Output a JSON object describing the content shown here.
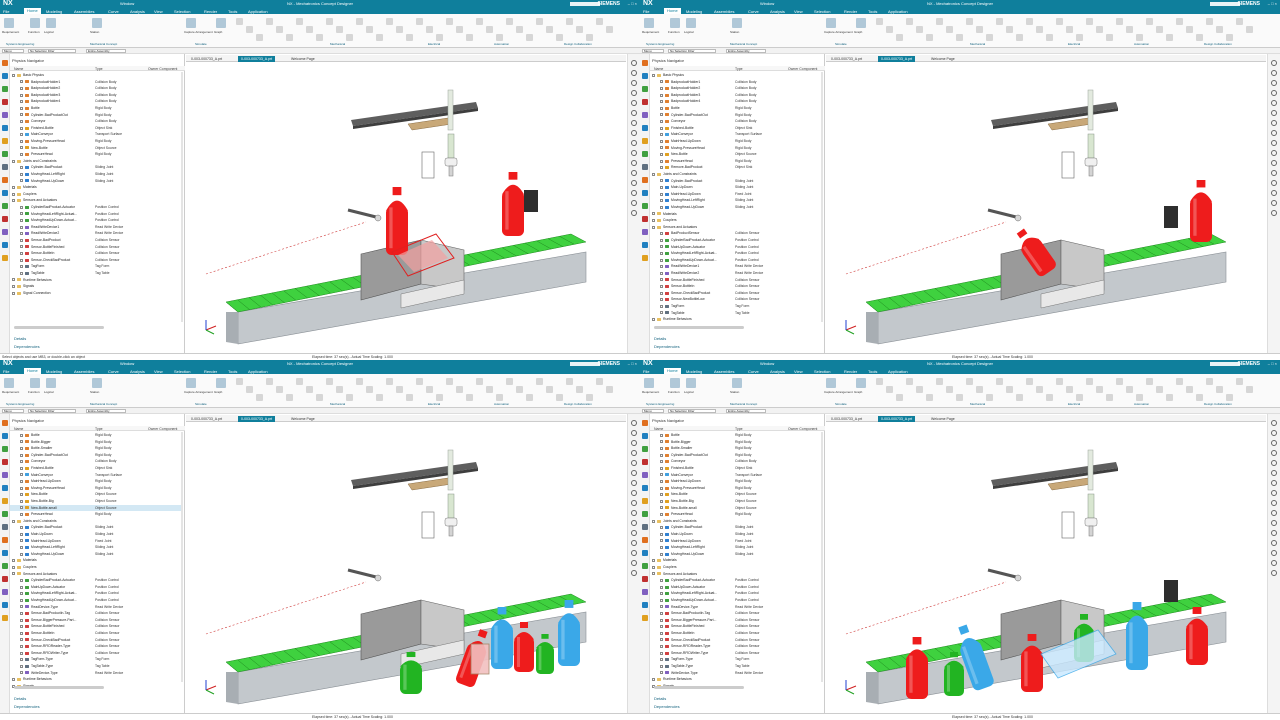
{
  "app": {
    "logo": "NX",
    "title": "NX - Mechatronics Concept Designer",
    "window_menu": "Window",
    "brand": "SIEMENS"
  },
  "menu": [
    "File",
    "Home",
    "Modeling",
    "Assemblies",
    "Curve",
    "Analysis",
    "View",
    "Selection",
    "Render",
    "Tools",
    "Application"
  ],
  "ribbon": {
    "tools": [
      "Requirement",
      "Function",
      "Logical",
      "Station",
      "Capture Arrangement",
      "Graph"
    ],
    "groups": [
      "Systems Engineering",
      "Mechanical Concept",
      "Simulate",
      "Mechanical",
      "Electrical",
      "Automation",
      "Design Collaboration"
    ]
  },
  "selection_bar": {
    "menu": "Menu",
    "filter": "No Selection Filter",
    "scope": "Entire Assembly"
  },
  "nav": {
    "title": "Physics Navigator",
    "col_name": "Name",
    "col_type": "Type",
    "col_owner": "Owner Component",
    "footer_details": "Details",
    "footer_dependencies": "Dependencies"
  },
  "tabs": [
    "0-003-000733_A.prt",
    "0-003-000733_A.prt",
    "Welcome Page"
  ],
  "status": {
    "message": "Select objects and use MB3, or double-click an object",
    "time": "Elapsed time: 37 sec(s) - Actual Time Scaling: 1.000"
  },
  "panels": [
    {
      "tree": [
        {
          "n": "Basic Physics",
          "t": "",
          "lv": 0,
          "f": true
        },
        {
          "n": "BadproductHolder1",
          "t": "Collision Body",
          "lv": 1
        },
        {
          "n": "BadproductHolder2",
          "t": "Collision Body",
          "lv": 1
        },
        {
          "n": "BadproductHolder3",
          "t": "Collision Body",
          "lv": 1
        },
        {
          "n": "BadproductHolder4",
          "t": "Collision Body",
          "lv": 1
        },
        {
          "n": "Bottle",
          "t": "Rigid Body",
          "lv": 1
        },
        {
          "n": "Cylinder-BadProductOut",
          "t": "Rigid Body",
          "lv": 1
        },
        {
          "n": "Conveyor",
          "t": "Collision Body",
          "lv": 1
        },
        {
          "n": "Finished-Bottle",
          "t": "Object Sink",
          "lv": 1
        },
        {
          "n": "MainConveyor",
          "t": "Transport Surface",
          "lv": 1
        },
        {
          "n": "Moving-PressureHead",
          "t": "Rigid Body",
          "lv": 1
        },
        {
          "n": "New-Bottle",
          "t": "Object Source",
          "lv": 1
        },
        {
          "n": "PressureHead",
          "t": "Rigid Body",
          "lv": 1
        },
        {
          "n": "Joints and Constraints",
          "t": "",
          "lv": 0,
          "f": true
        },
        {
          "n": "Cylinder-BadProduct",
          "t": "Sliding Joint",
          "lv": 1
        },
        {
          "n": "MovingHead-LeftRight",
          "t": "Sliding Joint",
          "lv": 1
        },
        {
          "n": "MovingHead-UpDown",
          "t": "Sliding Joint",
          "lv": 1
        },
        {
          "n": "Materials",
          "t": "",
          "lv": 0,
          "f": true
        },
        {
          "n": "Couplers",
          "t": "",
          "lv": 0,
          "f": true
        },
        {
          "n": "Sensors and Actuators",
          "t": "",
          "lv": 0,
          "f": true
        },
        {
          "n": "CylinderBadProduct-Actuator",
          "t": "Position Control",
          "lv": 1
        },
        {
          "n": "MovingHeadLeftRight-Actuat...",
          "t": "Position Control",
          "lv": 1
        },
        {
          "n": "MovingHeadUpDown-Actuat...",
          "t": "Position Control",
          "lv": 1
        },
        {
          "n": "ReadWriteDevice1",
          "t": "Read Write Device",
          "lv": 1
        },
        {
          "n": "ReadWriteDevice2",
          "t": "Read Write Device",
          "lv": 1
        },
        {
          "n": "Sensor-BadProduct",
          "t": "Collision Sensor",
          "lv": 1
        },
        {
          "n": "Sensor-BottleFinished",
          "t": "Collision Sensor",
          "lv": 1
        },
        {
          "n": "Sensor-BottleIn",
          "t": "Collision Sensor",
          "lv": 1
        },
        {
          "n": "Sensor-CheckBadProduct",
          "t": "Collision Sensor",
          "lv": 1
        },
        {
          "n": "TagForm",
          "t": "Tag Form",
          "lv": 1
        },
        {
          "n": "TagTable",
          "t": "Tag Table",
          "lv": 1
        },
        {
          "n": "Runtime Behaviors",
          "t": "",
          "lv": 0,
          "f": true
        },
        {
          "n": "Signals",
          "t": "",
          "lv": 0,
          "f": true
        },
        {
          "n": "Signal Connection",
          "t": "",
          "lv": 0,
          "f": true
        }
      ]
    },
    {
      "tree": [
        {
          "n": "Basic Physics",
          "t": "",
          "lv": 0,
          "f": true
        },
        {
          "n": "BadproductHolder1",
          "t": "Collision Body",
          "lv": 1
        },
        {
          "n": "BadproductHolder2",
          "t": "Collision Body",
          "lv": 1
        },
        {
          "n": "BadproductHolder3",
          "t": "Collision Body",
          "lv": 1
        },
        {
          "n": "BadproductHolder4",
          "t": "Collision Body",
          "lv": 1
        },
        {
          "n": "Bottle",
          "t": "Rigid Body",
          "lv": 1
        },
        {
          "n": "Cylinder-BadProductOut",
          "t": "Rigid Body",
          "lv": 1
        },
        {
          "n": "Conveyor",
          "t": "Collision Body",
          "lv": 1
        },
        {
          "n": "Finished-Bottle",
          "t": "Object Sink",
          "lv": 1
        },
        {
          "n": "MainConveyor",
          "t": "Transport Surface",
          "lv": 1
        },
        {
          "n": "MainHead-UpDown",
          "t": "Rigid Body",
          "lv": 1
        },
        {
          "n": "Moving-PressureHead",
          "t": "Rigid Body",
          "lv": 1
        },
        {
          "n": "New-Bottle",
          "t": "Object Source",
          "lv": 1
        },
        {
          "n": "PressureHead",
          "t": "Rigid Body",
          "lv": 1
        },
        {
          "n": "Remove-BadProduct",
          "t": "Object Sink",
          "lv": 1
        },
        {
          "n": "Joints and Constraints",
          "t": "",
          "lv": 0,
          "f": true
        },
        {
          "n": "Cylinder-BadProduct",
          "t": "Sliding Joint",
          "lv": 1
        },
        {
          "n": "Main-UpDown",
          "t": "Sliding Joint",
          "lv": 1
        },
        {
          "n": "MainHead-UpDown",
          "t": "Fixed Joint",
          "lv": 1
        },
        {
          "n": "MovingHead-LeftRight",
          "t": "Sliding Joint",
          "lv": 1
        },
        {
          "n": "MovingHead-UpDown",
          "t": "Sliding Joint",
          "lv": 1
        },
        {
          "n": "Materials",
          "t": "",
          "lv": 0,
          "f": true
        },
        {
          "n": "Couplers",
          "t": "",
          "lv": 0,
          "f": true
        },
        {
          "n": "Sensors and Actuators",
          "t": "",
          "lv": 0,
          "f": true
        },
        {
          "n": "BadProductSensor",
          "t": "Collision Sensor",
          "lv": 1
        },
        {
          "n": "CylinderBadProduct-Actuator",
          "t": "Position Control",
          "lv": 1
        },
        {
          "n": "MainUpDown-Actuator",
          "t": "Position Control",
          "lv": 1
        },
        {
          "n": "MovingHeadLeftRight-Actuat...",
          "t": "Position Control",
          "lv": 1
        },
        {
          "n": "MovingHeadUpDown-Actuat...",
          "t": "Position Control",
          "lv": 1
        },
        {
          "n": "ReadWriteDevice1",
          "t": "Read Write Device",
          "lv": 1
        },
        {
          "n": "ReadWriteDevice2",
          "t": "Read Write Device",
          "lv": 1
        },
        {
          "n": "Sensor-BottleFinished",
          "t": "Collision Sensor",
          "lv": 1
        },
        {
          "n": "Sensor-BottleIn",
          "t": "Collision Sensor",
          "lv": 1
        },
        {
          "n": "Sensor-CheckBadProduct",
          "t": "Collision Sensor",
          "lv": 1
        },
        {
          "n": "Sensor-NewBottleLow",
          "t": "Collision Sensor",
          "lv": 1
        },
        {
          "n": "TagForm",
          "t": "Tag Form",
          "lv": 1
        },
        {
          "n": "TagTable",
          "t": "Tag Table",
          "lv": 1
        },
        {
          "n": "Runtime Behaviors",
          "t": "",
          "lv": 0,
          "f": true
        }
      ]
    },
    {
      "tree": [
        {
          "n": "Bottle",
          "t": "Rigid Body",
          "lv": 1
        },
        {
          "n": "Bottle-Bigger",
          "t": "Rigid Body",
          "lv": 1
        },
        {
          "n": "Bottle-Smaller",
          "t": "Rigid Body",
          "lv": 1
        },
        {
          "n": "Cylinder-BadProductOut",
          "t": "Rigid Body",
          "lv": 1
        },
        {
          "n": "Conveyor",
          "t": "Collision Body",
          "lv": 1
        },
        {
          "n": "Finished-Bottle",
          "t": "Object Sink",
          "lv": 1
        },
        {
          "n": "MainConveyor",
          "t": "Transport Surface",
          "lv": 1
        },
        {
          "n": "MainHead-UpDown",
          "t": "Rigid Body",
          "lv": 1
        },
        {
          "n": "Moving-PressureHead",
          "t": "Rigid Body",
          "lv": 1
        },
        {
          "n": "New-Bottle",
          "t": "Object Source",
          "lv": 1
        },
        {
          "n": "New-Bottle-Big",
          "t": "Object Source",
          "lv": 1
        },
        {
          "n": "New-Bottle-small",
          "t": "Object Source",
          "lv": 1,
          "sel": true
        },
        {
          "n": "PressureHead",
          "t": "Rigid Body",
          "lv": 1
        },
        {
          "n": "Joints and Constraints",
          "t": "",
          "lv": 0,
          "f": true
        },
        {
          "n": "Cylinder-BadProduct",
          "t": "Sliding Joint",
          "lv": 1
        },
        {
          "n": "Main-UpDown",
          "t": "Sliding Joint",
          "lv": 1
        },
        {
          "n": "MainHead-UpDown",
          "t": "Fixed Joint",
          "lv": 1
        },
        {
          "n": "MovingHead-LeftRight",
          "t": "Sliding Joint",
          "lv": 1
        },
        {
          "n": "MovingHead-UpDown",
          "t": "Sliding Joint",
          "lv": 1
        },
        {
          "n": "Materials",
          "t": "",
          "lv": 0,
          "f": true
        },
        {
          "n": "Couplers",
          "t": "",
          "lv": 0,
          "f": true
        },
        {
          "n": "Sensors and Actuators",
          "t": "",
          "lv": 0,
          "f": true
        },
        {
          "n": "CylinderBadProduct-Actuator",
          "t": "Position Control",
          "lv": 1
        },
        {
          "n": "MainUpDown-Actuator",
          "t": "Position Control",
          "lv": 1
        },
        {
          "n": "MovingHeadLeftRight-Actuat...",
          "t": "Position Control",
          "lv": 1
        },
        {
          "n": "MovingHeadUpDown-Actuat...",
          "t": "Position Control",
          "lv": 1
        },
        {
          "n": "ReadDevice-Type",
          "t": "Read Write Device",
          "lv": 1
        },
        {
          "n": "Sensor-BadProductIn-Tag",
          "t": "Collision Sensor",
          "lv": 1
        },
        {
          "n": "Sensor-BiggerPressure-Part...",
          "t": "Collision Sensor",
          "lv": 1
        },
        {
          "n": "Sensor-BottleFinished",
          "t": "Collision Sensor",
          "lv": 1
        },
        {
          "n": "Sensor-BottleIn",
          "t": "Collision Sensor",
          "lv": 1
        },
        {
          "n": "Sensor-CheckBadProduct",
          "t": "Collision Sensor",
          "lv": 1
        },
        {
          "n": "Sensor-RFIDReader-Type",
          "t": "Collision Sensor",
          "lv": 1
        },
        {
          "n": "Sensor-RFIDWriter-Type",
          "t": "Collision Sensor",
          "lv": 1
        },
        {
          "n": "TagForm-Type",
          "t": "Tag Form",
          "lv": 1
        },
        {
          "n": "TagTable-Type",
          "t": "Tag Table",
          "lv": 1
        },
        {
          "n": "WriteDevice-Type",
          "t": "Read Write Device",
          "lv": 1
        },
        {
          "n": "Runtime Behaviors",
          "t": "",
          "lv": 0,
          "f": true
        },
        {
          "n": "Signals",
          "t": "",
          "lv": 0,
          "f": true
        }
      ]
    },
    {
      "tree": [
        {
          "n": "Bottle",
          "t": "Rigid Body",
          "lv": 1
        },
        {
          "n": "Bottle-Bigger",
          "t": "Rigid Body",
          "lv": 1
        },
        {
          "n": "Bottle-Smaller",
          "t": "Rigid Body",
          "lv": 1
        },
        {
          "n": "Cylinder-BadProductOut",
          "t": "Rigid Body",
          "lv": 1
        },
        {
          "n": "Conveyor",
          "t": "Collision Body",
          "lv": 1
        },
        {
          "n": "Finished-Bottle",
          "t": "Object Sink",
          "lv": 1
        },
        {
          "n": "MainConveyor",
          "t": "Transport Surface",
          "lv": 1
        },
        {
          "n": "MainHead-UpDown",
          "t": "Rigid Body",
          "lv": 1
        },
        {
          "n": "Moving-PressureHead",
          "t": "Rigid Body",
          "lv": 1
        },
        {
          "n": "New-Bottle",
          "t": "Object Source",
          "lv": 1
        },
        {
          "n": "New-Bottle-Big",
          "t": "Object Source",
          "lv": 1
        },
        {
          "n": "New-Bottle-small",
          "t": "Object Source",
          "lv": 1
        },
        {
          "n": "PressureHead",
          "t": "Rigid Body",
          "lv": 1
        },
        {
          "n": "Joints and Constraints",
          "t": "",
          "lv": 0,
          "f": true
        },
        {
          "n": "Cylinder-BadProduct",
          "t": "Sliding Joint",
          "lv": 1
        },
        {
          "n": "Main-UpDown",
          "t": "Sliding Joint",
          "lv": 1
        },
        {
          "n": "MainHead-UpDown",
          "t": "Fixed Joint",
          "lv": 1
        },
        {
          "n": "MovingHead-LeftRight",
          "t": "Sliding Joint",
          "lv": 1
        },
        {
          "n": "MovingHead-UpDown",
          "t": "Sliding Joint",
          "lv": 1
        },
        {
          "n": "Materials",
          "t": "",
          "lv": 0,
          "f": true
        },
        {
          "n": "Couplers",
          "t": "",
          "lv": 0,
          "f": true
        },
        {
          "n": "Sensors and Actuators",
          "t": "",
          "lv": 0,
          "f": true
        },
        {
          "n": "CylinderBadProduct-Actuator",
          "t": "Position Control",
          "lv": 1
        },
        {
          "n": "MainUpDown-Actuator",
          "t": "Position Control",
          "lv": 1
        },
        {
          "n": "MovingHeadLeftRight-Actuat...",
          "t": "Position Control",
          "lv": 1
        },
        {
          "n": "MovingHeadUpDown-Actuat...",
          "t": "Position Control",
          "lv": 1
        },
        {
          "n": "ReadDevice-Type",
          "t": "Read Write Device",
          "lv": 1
        },
        {
          "n": "Sensor-BadProductIn-Tag",
          "t": "Collision Sensor",
          "lv": 1
        },
        {
          "n": "Sensor-BiggerPressure-Part...",
          "t": "Collision Sensor",
          "lv": 1
        },
        {
          "n": "Sensor-BottleFinished",
          "t": "Collision Sensor",
          "lv": 1
        },
        {
          "n": "Sensor-BottleIn",
          "t": "Collision Sensor",
          "lv": 1
        },
        {
          "n": "Sensor-CheckBadProduct",
          "t": "Collision Sensor",
          "lv": 1
        },
        {
          "n": "Sensor-RFIDReader-Type",
          "t": "Collision Sensor",
          "lv": 1
        },
        {
          "n": "Sensor-RFIDWriter-Type",
          "t": "Collision Sensor",
          "lv": 1
        },
        {
          "n": "TagForm-Type",
          "t": "Tag Form",
          "lv": 1
        },
        {
          "n": "TagTable-Type",
          "t": "Tag Table",
          "lv": 1
        },
        {
          "n": "WriteDevice-Type",
          "t": "Read Write Device",
          "lv": 1
        },
        {
          "n": "Runtime Behaviors",
          "t": "",
          "lv": 0,
          "f": true
        },
        {
          "n": "Signals",
          "t": "",
          "lv": 0,
          "f": true
        }
      ]
    }
  ],
  "colors": {
    "title_bar": "#0f7f9c",
    "conveyor_green": "#3fd13f",
    "bottle_red": "#ee1c1c",
    "bottle_blue": "#3aa8e8",
    "bottle_green": "#22b422",
    "conveyor_grey": "#c3c8cc"
  }
}
